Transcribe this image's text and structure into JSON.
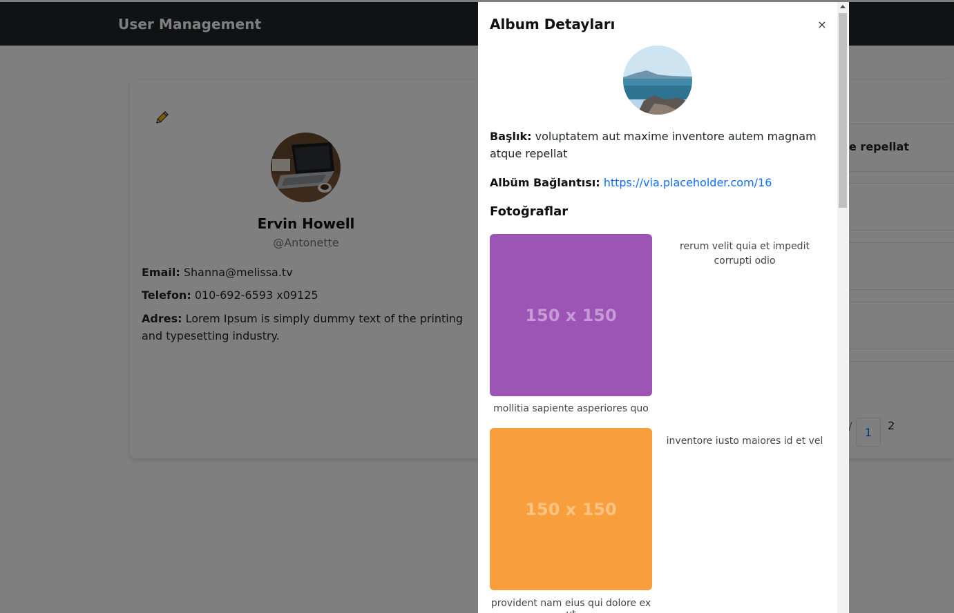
{
  "navbar": {
    "brand": "User Management"
  },
  "profile": {
    "name": "Ervin Howell",
    "username": "@Antonette",
    "email_label": "Email:",
    "email": "Shanna@melissa.tv",
    "phone_label": "Telefon:",
    "phone": "010-692-6593 x09125",
    "address_label": "Adres:",
    "address": "Lorem Ipsum is simply dummy text of the printing and typesetting industry."
  },
  "album_list": {
    "visible_title_fragment": "e repellat",
    "pagination": {
      "pages": [
        "1",
        "2"
      ],
      "active": "1",
      "prev_fragment": "/"
    }
  },
  "modal": {
    "title": "Album Detayları",
    "close_label": "×",
    "title_label": "Başlık:",
    "album_title": "voluptatem aut maxime inventore autem magnam atque repellat",
    "link_label": "Albüm Bağlantısı:",
    "link_url": "https://via.placeholder.com/16",
    "photos_heading": "Fotoğraflar",
    "photos": [
      {
        "placeholder_text": "150 x 150",
        "color": "#9c55b4",
        "caption_below": "mollitia sapiente asperiores quo",
        "caption_side": "rerum velit quia et impedit corrupti odio"
      },
      {
        "placeholder_text": "150 x 150",
        "color": "#f99e3c",
        "caption_below": "provident nam eius qui dolore ex ut",
        "caption_side": "inventore iusto maiores id et vel"
      }
    ]
  },
  "colors": {
    "navbar_bg": "#212529",
    "link": "#0d6efd",
    "overlay": "rgba(0,0,0,0.5)"
  }
}
